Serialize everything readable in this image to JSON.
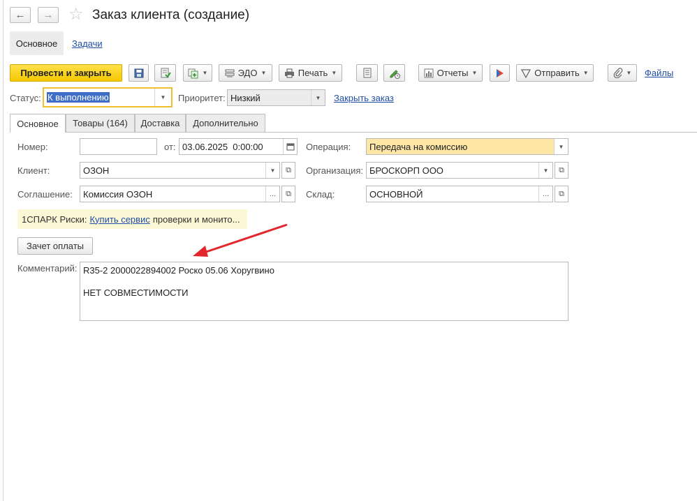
{
  "window": {
    "title": "Заказ клиента (создание)",
    "back_icon": "←",
    "forward_icon": "→",
    "star_icon": "☆"
  },
  "sections": {
    "main_label": "Основное",
    "tasks_label": "Задачи"
  },
  "toolbar": {
    "post_close_label": "Провести и закрыть",
    "edo_label": "ЭДО",
    "print_label": "Печать",
    "reports_label": "Отчеты",
    "send_label": "Отправить",
    "files_label": "Файлы"
  },
  "status": {
    "label": "Статус:",
    "value": "К выполнению",
    "priority_label": "Приоритет:",
    "priority_value": "Низкий",
    "close_order_label": "Закрыть заказ"
  },
  "tabs": [
    {
      "label": "Основное"
    },
    {
      "label": "Товары (164)"
    },
    {
      "label": "Доставка"
    },
    {
      "label": "Дополнительно"
    }
  ],
  "form": {
    "number_label": "Номер:",
    "number_value": "",
    "date_from_label": "от:",
    "date_value": "03.06.2025  0:00:00",
    "operation_label": "Операция:",
    "operation_value": "Передача на комиссию",
    "client_label": "Клиент:",
    "client_value": "ОЗОН",
    "organization_label": "Организация:",
    "organization_value": "БРОСКОРП ООО",
    "agreement_label": "Соглашение:",
    "agreement_value": "Комиссия ОЗОН",
    "warehouse_label": "Склад:",
    "warehouse_value": "ОСНОВНОЙ"
  },
  "spark": {
    "prefix": "1СПАРК Риски:",
    "link": "Купить сервис",
    "suffix": "проверки и монито..."
  },
  "payment_offset_label": "Зачет оплаты",
  "comment": {
    "label": "Комментарий:",
    "line1": "R35-2 2000022894002 Роско 05.06 Хоругвино",
    "line2": "НЕТ СОВМЕСТИМОСТИ"
  },
  "colors": {
    "accent_yellow": "#f6c800",
    "operation_highlight": "#fde6a6",
    "link_blue": "#1f4ea5",
    "arrow_red": "#e3262b"
  }
}
